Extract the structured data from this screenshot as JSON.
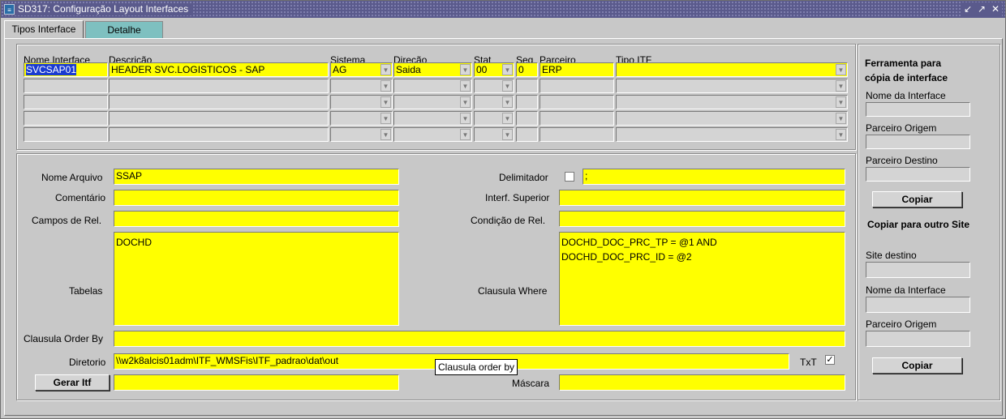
{
  "window": {
    "title": "SD317: Configuração Layout Interfaces",
    "icon": "app-icon",
    "buttons": [
      "minimize-icon",
      "restore-icon",
      "close-icon"
    ]
  },
  "tabs": [
    {
      "label": "Tipos Interface"
    },
    {
      "label": "Detalhe"
    }
  ],
  "grid": {
    "headers": {
      "nome": "Nome Interface",
      "descricao": "Descrição",
      "sistema": "Sistema",
      "direcao": "Direção",
      "stat": "Stat",
      "seq": "Seq",
      "parceiro": "Parceiro",
      "tipo": "Tipo ITF"
    },
    "row0": {
      "nome": "SVCSAP01",
      "descricao": "HEADER SVC.LOGISTICOS - SAP",
      "sistema": "AG",
      "direcao": "Saida",
      "stat": "00",
      "seq": "0",
      "parceiro": "ERP",
      "tipo": ""
    }
  },
  "detail": {
    "nome_arquivo_label": "Nome Arquivo",
    "nome_arquivo": "SSAP",
    "comentario_label": "Comentário",
    "comentario": "",
    "campos_label": "Campos de Rel.",
    "campos": "",
    "tabelas_label": "Tabelas",
    "tabelas": "DOCHD",
    "order_by_label": "Clausula Order By",
    "order_by": "",
    "diretorio_label": "Diretorio",
    "diretorio": "\\\\w2k8alcis01adm\\ITF_WMSFis\\ITF_padrao\\dat\\out",
    "gerar_label": "Gerar Itf",
    "gerar_value": "",
    "delimitador_label": "Delimitador",
    "delimitador": ";",
    "interf_label": "Interf. Superior",
    "interf": "",
    "condicao_label": "Condição de Rel.",
    "condicao": "",
    "where_label": "Clausula Where",
    "where": "DOCHD_DOC_PRC_TP = @1 AND\nDOCHD_DOC_PRC_ID = @2",
    "txt_label": "TxT",
    "mascara_label": "Máscara",
    "mascara": "",
    "tooltip": "Clausula  order by"
  },
  "tool": {
    "head1": "Ferramenta para cópia de interface",
    "nome_label": "Nome da Interface",
    "parceiro_origem_label": "Parceiro Origem",
    "parceiro_destino_label": "Parceiro Destino",
    "copiar1": "Copiar",
    "head2": "Copiar para outro Site",
    "site_label": "Site destino",
    "nome2_label": "Nome da Interface",
    "parceiro2_label": "Parceiro Origem",
    "copiar2": "Copiar"
  },
  "colors": {
    "field": "#ffff00",
    "title_bar": "#5a5a8c",
    "tab_inactive": "#7ec0c0",
    "selection": "#1a3bd0"
  }
}
